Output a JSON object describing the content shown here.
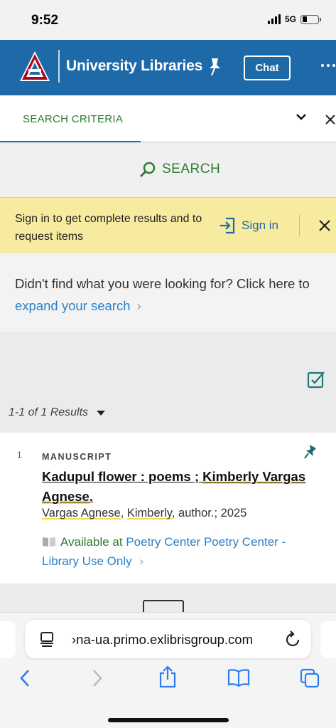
{
  "status_bar": {
    "time": "9:52",
    "network": "5G",
    "battery_level": 0.3
  },
  "header": {
    "title": "University Libraries",
    "chat_label": "Chat"
  },
  "search_criteria": {
    "tab_label": "SEARCH CRITERIA"
  },
  "search_button": {
    "label": "SEARCH"
  },
  "signin_banner": {
    "message": "Sign in to get complete results and to request items",
    "link_label": "Sign in"
  },
  "expand": {
    "prefix": "Didn't find what you were looking for? Click here to",
    "link_label": "expand your search",
    "chevron": "›"
  },
  "results": {
    "count_label": "1-1 of 1 Results"
  },
  "result": {
    "number": "1",
    "type": "MANUSCRIPT",
    "title_a": "Kadupul flower : poems ; ",
    "title_b": "Kimberly Vargas Agnese",
    "title_c": ".",
    "author_a": "Vargas Agnese",
    "author_sep": ", ",
    "author_b": "Kimberly",
    "author_rest": ", author.; 2025",
    "availability_prefix": "Available at",
    "location_1": "Poetry Center",
    "location_2": "Poetry Center - Library Use Only",
    "chevron": "›"
  },
  "browser": {
    "url": "›na-ua.primo.exlibrisgroup.com"
  },
  "colors": {
    "header_blue": "#1e6aa9",
    "accent_green": "#2e7d32",
    "link_blue": "#2f80c4",
    "banner_yellow": "#f7eba0",
    "highlight_yellow": "#f6d94c"
  },
  "icons": [
    "signal-icon",
    "battery-icon",
    "arizona-a-logo",
    "pin-icon",
    "more-icon",
    "chevron-down-icon",
    "close-icon",
    "search-icon",
    "sign-in-icon",
    "select-all-icon",
    "book-icon",
    "page-icon",
    "reload-icon",
    "back-icon",
    "forward-icon",
    "share-icon",
    "bookmarks-icon",
    "tabs-icon"
  ]
}
